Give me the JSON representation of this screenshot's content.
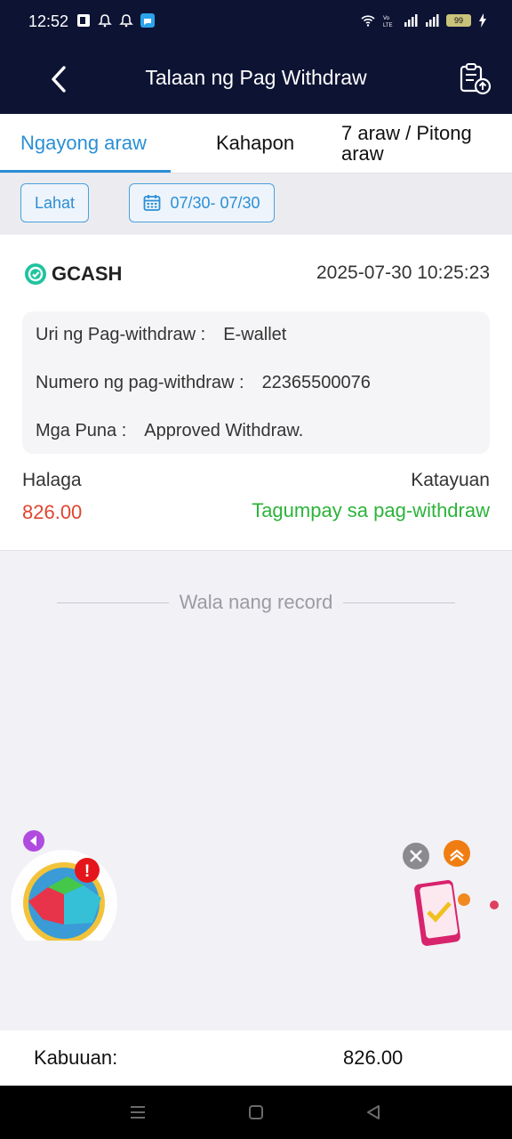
{
  "status_bar": {
    "time": "12:52",
    "battery": "99",
    "icons": [
      "wallet-app-icon",
      "bell-icon",
      "bell-icon",
      "chat-app-icon",
      "wifi-icon",
      "volte-icon",
      "signal-icon",
      "signal-icon",
      "battery-icon",
      "charging-icon"
    ]
  },
  "header": {
    "title": "Talaan ng Pag Withdraw"
  },
  "tabs": [
    {
      "label": "Ngayong araw",
      "active": true
    },
    {
      "label": "Kahapon",
      "active": false
    },
    {
      "label": "7 araw / Pitong araw",
      "active": false
    }
  ],
  "filters": {
    "all_label": "Lahat",
    "date_range": "07/30- 07/30"
  },
  "record": {
    "method": "GCASH",
    "datetime": "2025-07-30 10:25:23",
    "type_label": "Uri ng Pag-withdraw :",
    "type_value": "E-wallet",
    "number_label": "Numero ng pag-withdraw :",
    "number_value": "22365500076",
    "remarks_label": "Mga Puna :",
    "remarks_value": "Approved Withdraw.",
    "amount_label": "Halaga",
    "amount_value": "826.00",
    "status_label": "Katayuan",
    "status_value": "Tagumpay sa pag-withdraw"
  },
  "no_more_records": "Wala nang record",
  "footer": {
    "total_label": "Kabuuan:",
    "total_value": "826.00"
  },
  "colors": {
    "header_bg": "#0d1333",
    "accent": "#2a8fd6",
    "amount": "#e0452f",
    "success": "#2db33a"
  }
}
